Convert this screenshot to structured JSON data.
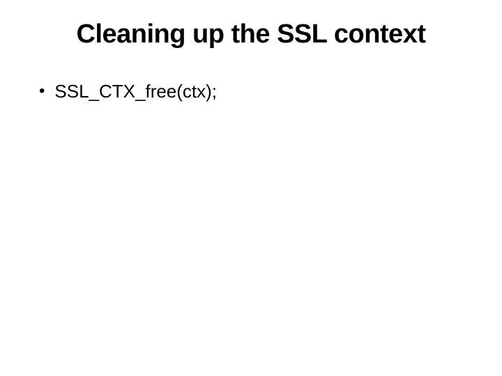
{
  "slide": {
    "title": "Cleaning up the SSL context",
    "bullets": [
      {
        "marker": "•",
        "text": "SSL_CTX_free(ctx);"
      }
    ]
  }
}
